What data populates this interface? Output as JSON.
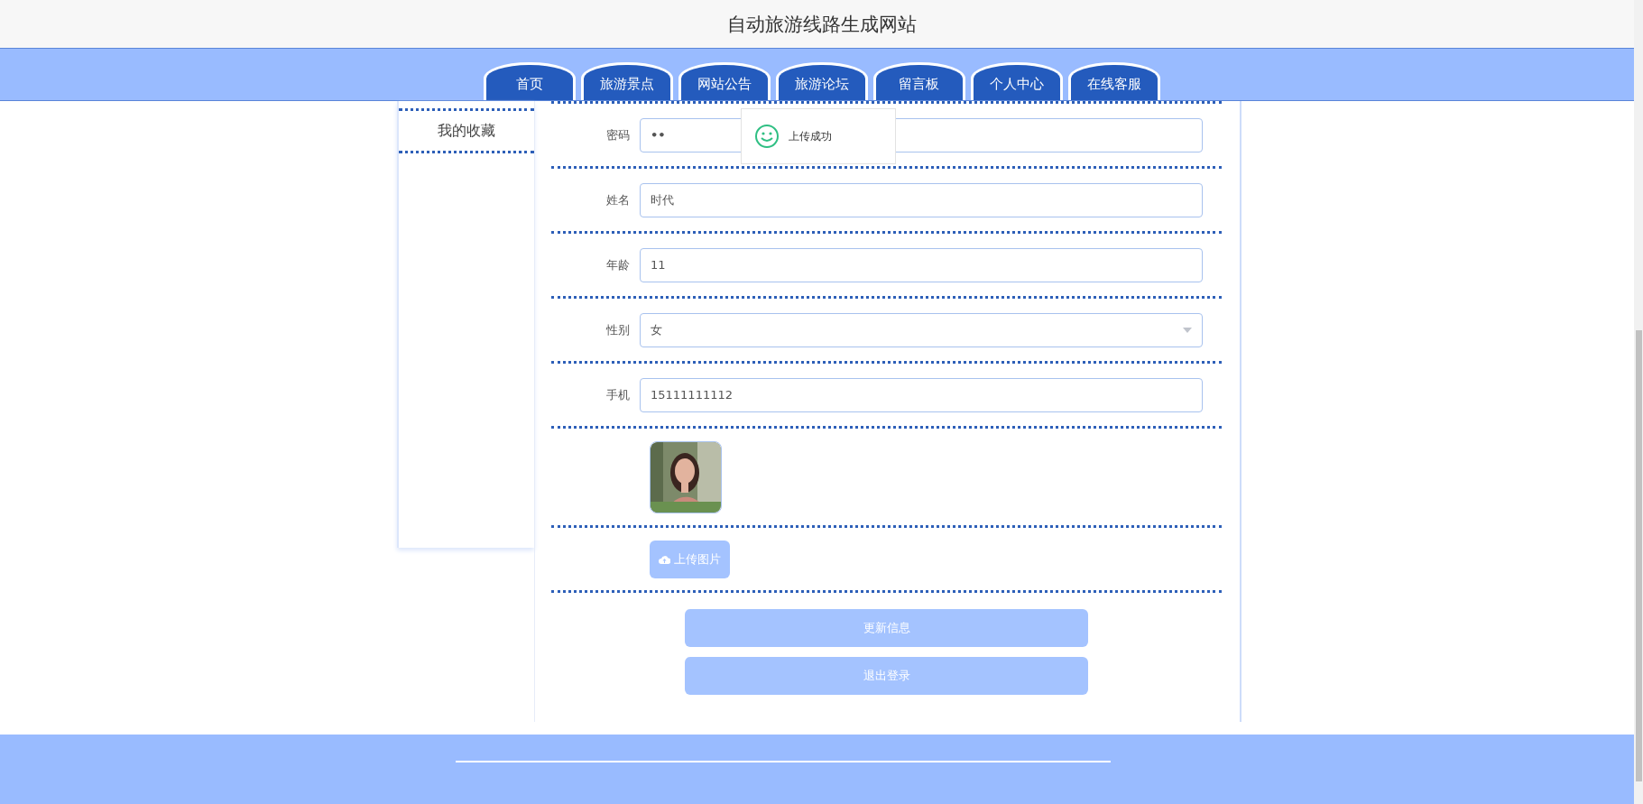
{
  "site_title": "自动旅游线路生成网站",
  "nav_tabs": [
    {
      "label": "首页"
    },
    {
      "label": "旅游景点"
    },
    {
      "label": "网站公告"
    },
    {
      "label": "旅游论坛"
    },
    {
      "label": "留言板"
    },
    {
      "label": "个人中心"
    },
    {
      "label": "在线客服"
    }
  ],
  "sidebar": {
    "items": [
      {
        "label": "我的收藏"
      }
    ]
  },
  "form": {
    "fields": [
      {
        "kind": "password",
        "label": "密码",
        "value": "••"
      },
      {
        "kind": "text",
        "label": "姓名",
        "value": "时代"
      },
      {
        "kind": "text",
        "label": "年龄",
        "value": "11"
      },
      {
        "kind": "select",
        "label": "性别",
        "value": "女"
      },
      {
        "kind": "text",
        "label": "手机",
        "value": "15111111112"
      }
    ],
    "upload_button": "上传图片",
    "actions": [
      "更新信息",
      "退出登录"
    ]
  },
  "toast": {
    "message": "上传成功"
  }
}
